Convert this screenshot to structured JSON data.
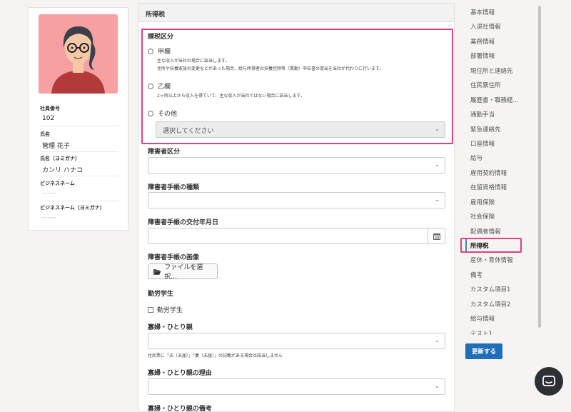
{
  "profile": {
    "employee_no_label": "社員番号",
    "employee_no": "102",
    "name_label": "氏名",
    "name": "管理 花子",
    "kana_label": "氏名（ヨミガナ）",
    "kana": "カンリ ハナコ",
    "business_name_label": "ビジネスネーム",
    "business_name": "-----",
    "business_kana_label": "ビジネスネーム（ヨミガナ）",
    "business_kana": "-----"
  },
  "form": {
    "header": "所得税",
    "tax_category_label": "課税区分",
    "option_kou": "甲欄",
    "option_kou_desc1": "主な収入が当社の場合に該当します。",
    "option_kou_desc2": "住所や扶養家族の変更などがあった場合、給与所得者の扶養控除等（異動）申告書の提出を当社が代わりに行います。",
    "option_otsu": "乙欄",
    "option_otsu_desc": "2ヶ所以上から収入を得ていて、主な収入が当社ではない場合に該当します。",
    "option_other": "その他",
    "other_select_placeholder": "選択してください",
    "disability_label": "障害者区分",
    "disability_value": "",
    "handbook_type_label": "障害者手帳の種類",
    "handbook_type_value": "",
    "handbook_date_label": "障害者手帳の交付年月日",
    "handbook_image_label": "障害者手帳の画像",
    "file_button": "ファイルを選択...",
    "student_label": "勤労学生",
    "student_checkbox": "勤労学生",
    "widow_label": "寡婦・ひとり親",
    "widow_value": "",
    "widow_note": "住民票に「夫（未届）」「妻（未届）」の記載がある場合は該当しません",
    "widow_reason_label": "寡婦・ひとり親の理由",
    "widow_reason_value": "",
    "widow_memo_label": "寡婦・ひとり親の備考"
  },
  "nav": {
    "items": [
      "基本情報",
      "入退社情報",
      "業務情報",
      "部署情報",
      "現住所と連絡先",
      "住民票住所",
      "履歴書・職務経...",
      "通勤手当",
      "緊急連絡先",
      "口座情報",
      "給与",
      "雇用契約情報",
      "在留資格情報",
      "雇用保険",
      "社会保険",
      "配偶者情報",
      "所得税",
      "産休・育休情報",
      "備考",
      "カスタム項目1",
      "カスタム項目2",
      "給与情報",
      "テスト1"
    ],
    "active_index": 16,
    "update_button": "更新する"
  },
  "colors": {
    "highlight": "#e0417f",
    "primary_button": "#1f6eb7",
    "active_indicator": "#2a8fd6",
    "avatar_bg": "#f7a0a2"
  }
}
